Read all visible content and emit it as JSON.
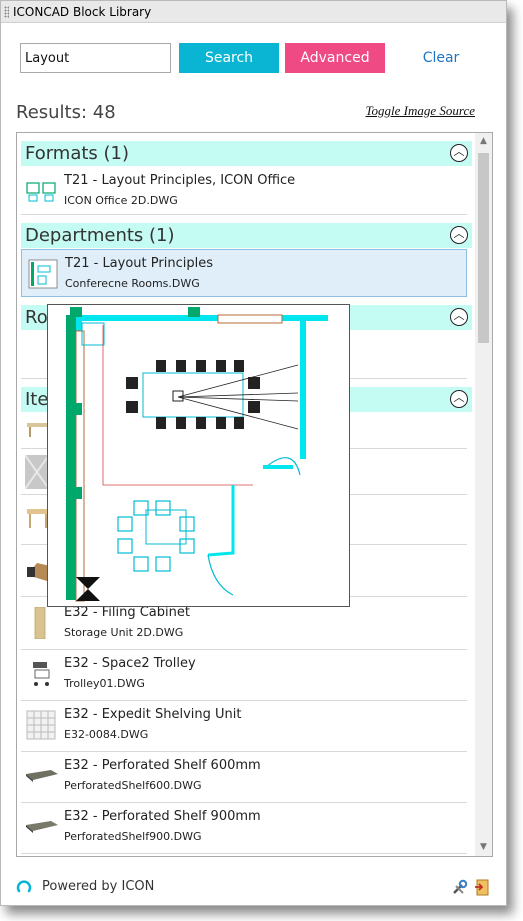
{
  "window": {
    "title": "ICONCAD Block Library"
  },
  "search": {
    "value": "Layout",
    "search_label": "Search",
    "advanced_label": "Advanced",
    "clear_label": "Clear"
  },
  "results": {
    "label": "Results: 48"
  },
  "toggle_label": "Toggle Image Source",
  "groups": [
    {
      "title": "Formats (1)",
      "items": [
        {
          "title": "T21 - Layout Principles, ICON Office",
          "file": "ICON Office 2D.DWG"
        }
      ]
    },
    {
      "title": "Departments (1)",
      "items": [
        {
          "title": "T21 - Layout Principles",
          "file": "Conferecne Rooms.DWG"
        }
      ]
    },
    {
      "title": "Ro"
    },
    {
      "title": "Ite"
    }
  ],
  "items_list": [
    {
      "title": "E32 - Filing Cabinet",
      "file": "Storage Unit 2D.DWG"
    },
    {
      "title": "E32 - Space2 Trolley",
      "file": "Trolley01.DWG"
    },
    {
      "title": "E32 - Expedit Shelving Unit",
      "file": "E32-0084.DWG"
    },
    {
      "title": "E32 - Perforated Shelf 600mm",
      "file": "PerforatedShelf600.DWG"
    },
    {
      "title": "E32 - Perforated Shelf 900mm",
      "file": "PerforatedShelf900.DWG"
    }
  ],
  "footer": {
    "powered_by": "Powered by ICON"
  },
  "colors": {
    "search_button": "#09b5d3",
    "advanced_button": "#ef4a83",
    "clear_text": "#1f74c4",
    "group_header_bg": "#c4fbf3",
    "selected_bg": "#dfeef8",
    "cad_cyan": "#00e5ee",
    "cad_green": "#00a86b"
  },
  "icons": [
    "collapse-icon",
    "tools-icon",
    "exit-icon",
    "icon-logo"
  ]
}
